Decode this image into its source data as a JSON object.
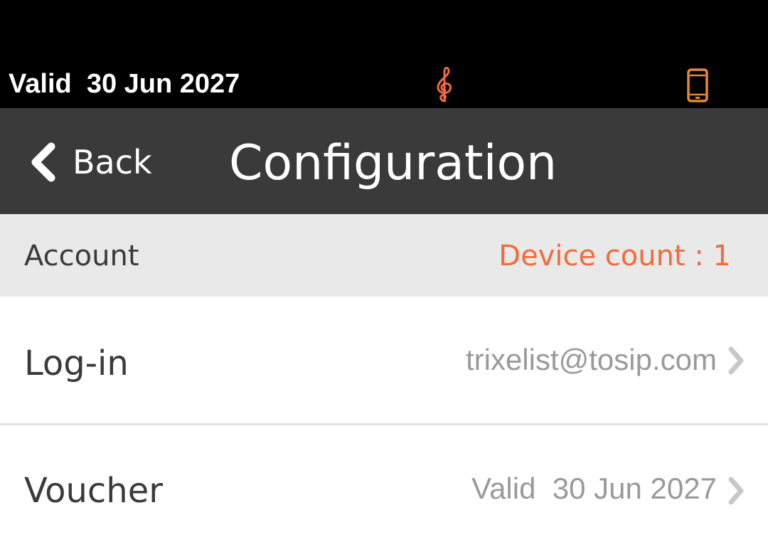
{
  "status_bar": {
    "validity_text": "Valid  30 Jun 2027",
    "music_icon": "treble-clef-icon",
    "device_icon": "smartphone-icon",
    "accent_color": "#f26b3a"
  },
  "nav_bar": {
    "back_label": "Back",
    "back_icon": "chevron-left-icon",
    "title": "Configuration"
  },
  "account_section": {
    "label": "Account",
    "device_count": "Device count : 1"
  },
  "rows": [
    {
      "label": "Log-in",
      "value": "trixelist@tosip.com",
      "icon": "chevron-right-icon"
    },
    {
      "label": "Voucher",
      "value": "Valid  30 Jun 2027",
      "icon": "chevron-right-icon"
    }
  ]
}
